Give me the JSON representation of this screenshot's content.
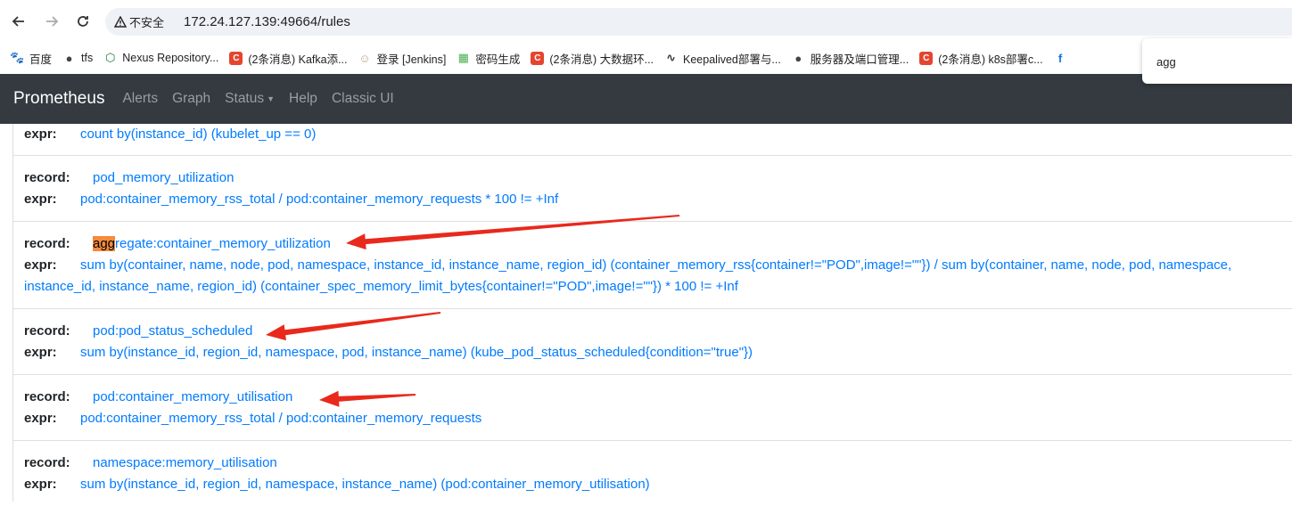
{
  "browser": {
    "insecure_label": "不安全",
    "url": "172.24.127.139:49664/rules",
    "bookmarks": [
      {
        "label": "百度",
        "icon": "paw-icon",
        "color": "#2932e1"
      },
      {
        "label": "tfs",
        "icon": "globe-icon",
        "color": "#444444"
      },
      {
        "label": "Nexus Repository...",
        "icon": "hexagon-icon",
        "color": "#1b7c3e"
      },
      {
        "label": "(2条消息) Kafka添...",
        "icon": "c-icon",
        "color": "#e4452f"
      },
      {
        "label": "登录 [Jenkins]",
        "icon": "jenkins-icon",
        "color": "#b7a48c"
      },
      {
        "label": "密码生成",
        "icon": "grid-icon",
        "color": "#4caf50"
      },
      {
        "label": "(2条消息) 大数据环...",
        "icon": "c-icon",
        "color": "#e4452f"
      },
      {
        "label": "Keepalived部署与...",
        "icon": "wave-icon",
        "color": "#333333"
      },
      {
        "label": "服务器及端口管理...",
        "icon": "globe-icon",
        "color": "#444444"
      },
      {
        "label": "(2条消息) k8s部署c...",
        "icon": "c-icon",
        "color": "#e4452f"
      }
    ],
    "find_query": "agg"
  },
  "navbar": {
    "brand": "Prometheus",
    "links": [
      "Alerts",
      "Graph",
      "Status",
      "Help",
      "Classic UI"
    ]
  },
  "rules": {
    "record_label": "record:",
    "expr_label": "expr:",
    "items": [
      {
        "expr": "count by(instance_id) (kubelet_up == 0)"
      },
      {
        "record": "pod_memory_utilization",
        "expr": "pod:container_memory_rss_total / pod:container_memory_requests * 100 != +Inf"
      },
      {
        "record_hl": "agg",
        "record_rest": "regate:container_memory_utilization",
        "expr": "sum by(container, name, node, pod, namespace, instance_id, instance_name, region_id) (container_memory_rss{container!=\"POD\",image!=\"\"}) / sum by(container, name, node, pod, namespace, instance_id, instance_name, region_id) (container_spec_memory_limit_bytes{container!=\"POD\",image!=\"\"}) * 100 != +Inf"
      },
      {
        "record": "pod:pod_status_scheduled",
        "expr": "sum by(instance_id, region_id, namespace, pod, instance_name) (kube_pod_status_scheduled{condition=\"true\"})"
      },
      {
        "record": "pod:container_memory_utilisation",
        "expr": "pod:container_memory_rss_total / pod:container_memory_requests"
      },
      {
        "record": "namespace:memory_utilisation",
        "expr": "sum by(instance_id, region_id, namespace, instance_name) (pod:container_memory_utilisation)"
      }
    ]
  },
  "annotation_color": "#e8291c"
}
